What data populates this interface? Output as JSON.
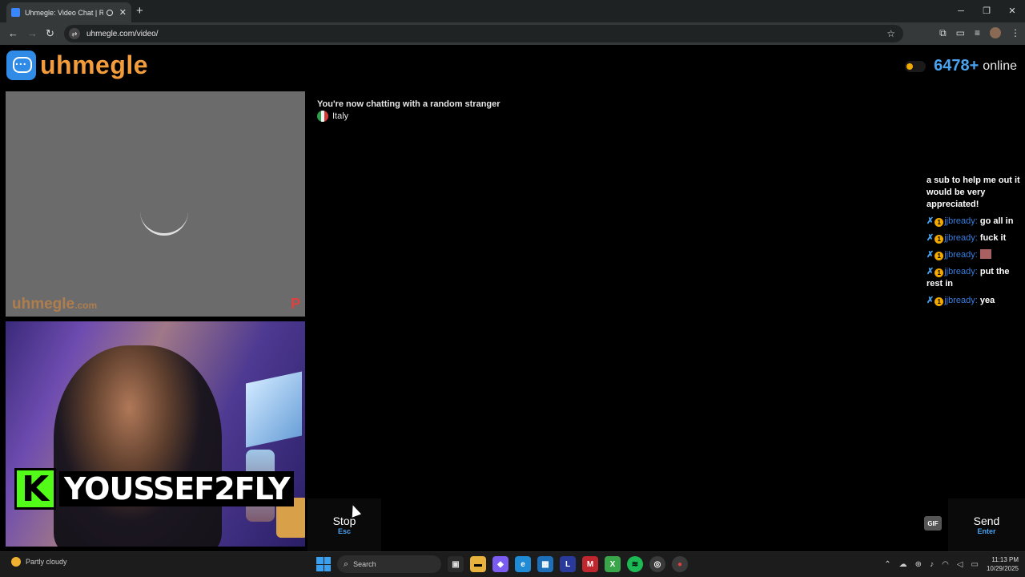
{
  "browser": {
    "tab_title": "Uhmegle: Video Chat | Ran",
    "url": "uhmegle.com/video/"
  },
  "header": {
    "brand": "uhmegle",
    "online_count": "6478+",
    "online_label": "online"
  },
  "video": {
    "watermark": "uhmegle",
    "watermark_suffix": ".com",
    "watermark_p": "P"
  },
  "chat": {
    "intro": "You're now chatting with a random stranger",
    "country": "Italy"
  },
  "overlay_chat": {
    "first_message": "a sub to help me out it would be very appreciated!",
    "messages": [
      {
        "user": "jjbready:",
        "text": "go all in"
      },
      {
        "user": "jjbready:",
        "text": "fuck it"
      },
      {
        "user": "jjbready:",
        "text": ""
      },
      {
        "user": "jjbready:",
        "text": "put the rest in"
      },
      {
        "user": "jjbready:",
        "text": "yea"
      }
    ]
  },
  "streamer": {
    "logo_letter": "K",
    "name": "YOUSSEF2FLY"
  },
  "controls": {
    "stop_label": "Stop",
    "stop_key": "Esc",
    "gif_label": "GIF",
    "send_label": "Send",
    "send_key": "Enter"
  },
  "taskbar": {
    "weather": "Partly cloudy",
    "search_placeholder": "Search",
    "time": "11:13 PM",
    "date": "10/29/2025"
  }
}
